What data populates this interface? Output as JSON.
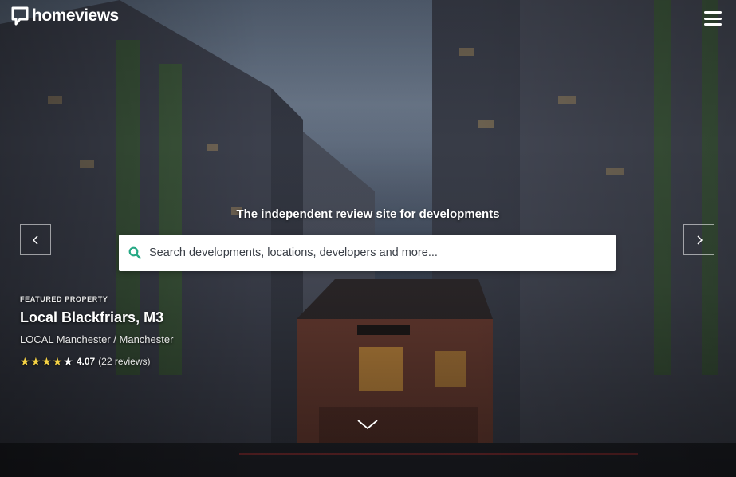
{
  "header": {
    "logo_text": "homeviews",
    "logo_icon": "homeviews-speech-bubble-icon",
    "menu_icon": "hamburger-menu-icon"
  },
  "hero": {
    "tagline": "The independent review site for developments",
    "search": {
      "placeholder": "Search developments, locations, developers and more...",
      "value": "",
      "icon": "search-icon"
    },
    "prev_icon": "chevron-left-icon",
    "next_icon": "chevron-right-icon",
    "scroll_icon": "chevron-down-icon"
  },
  "featured": {
    "label": "FEATURED PROPERTY",
    "name": "Local Blackfriars, M3",
    "developer_location": "LOCAL Manchester  / Manchester",
    "rating_value": "4.07",
    "rating_stars": 4.07,
    "reviews": "(22 reviews)"
  },
  "colors": {
    "accent": "#27a985",
    "star": "#f5d245",
    "search_bg": "#ffffff"
  }
}
